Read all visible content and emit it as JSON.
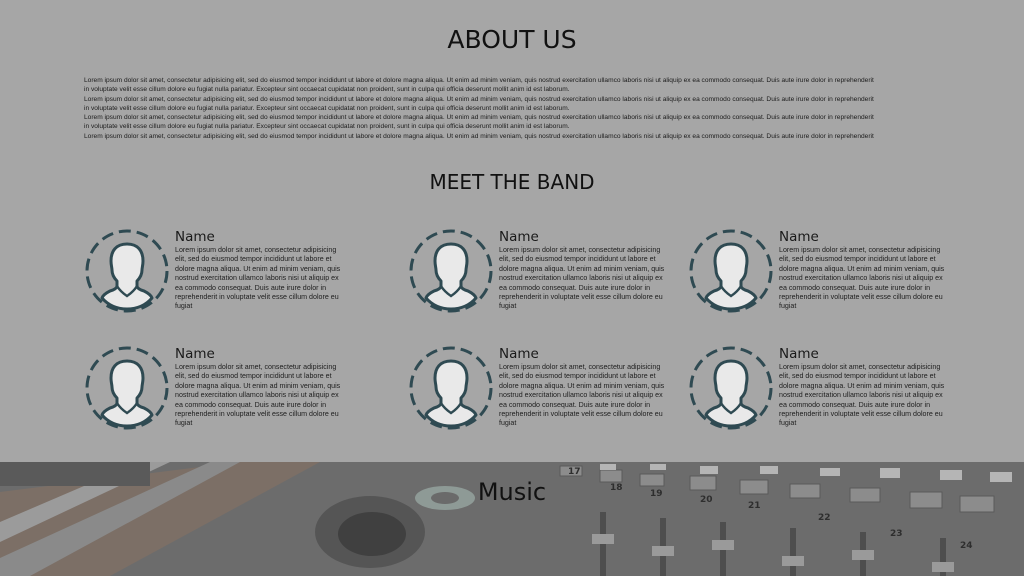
{
  "about": {
    "title": "ABOUT US",
    "paragraph_lines": [
      "Lorem ipsum dolor sit amet, consectetur adipisicing elit, sed do eiusmod tempor incididunt ut labore et dolore magna aliqua. Ut enim ad minim veniam, quis nostrud exercitation ullamco laboris nisi ut aliquip ex ea commodo consequat. Duis aute irure dolor in reprehenderit",
      "in voluptate velit esse cillum dolore eu fugiat nulla pariatur. Excepteur sint occaecat cupidatat non proident, sunt in culpa qui officia deserunt mollit anim id est laborum.",
      "Lorem ipsum dolor sit amet, consectetur adipisicing elit, sed do eiusmod tempor incididunt ut labore et dolore magna aliqua. Ut enim ad minim veniam, quis nostrud exercitation ullamco laboris nisi ut aliquip ex ea commodo consequat. Duis aute irure dolor in reprehenderit",
      "in voluptate velit esse cillum dolore eu fugiat nulla pariatur. Excepteur sint occaecat cupidatat non proident, sunt in culpa qui officia deserunt mollit anim id est laborum.",
      "Lorem ipsum dolor sit amet, consectetur adipisicing elit, sed do eiusmod tempor incididunt ut labore et dolore magna aliqua. Ut enim ad minim veniam, quis nostrud exercitation ullamco laboris nisi ut aliquip ex ea commodo consequat. Duis aute irure dolor in reprehenderit",
      "in voluptate velit esse cillum dolore eu fugiat nulla pariatur. Excepteur sint occaecat cupidatat non proident, sunt in culpa qui officia deserunt mollit anim id est laborum.",
      "Lorem ipsum dolor sit amet, consectetur adipisicing elit, sed do eiusmod tempor incididunt ut labore et dolore magna aliqua. Ut enim ad minim veniam, quis nostrud exercitation ullamco laboris nisi ut aliquip ex ea commodo consequat. Duis aute irure dolor in reprehenderit"
    ]
  },
  "band": {
    "title": "MEET THE BAND",
    "avatar_icon": "user-avatar-icon",
    "avatar_color": "#2f4a52",
    "members": [
      {
        "name": "Name",
        "bio": "Lorem ipsum dolor sit amet, consectetur adipisicing elit, sed do eiusmod tempor incididunt ut labore et dolore magna aliqua. Ut enim ad minim veniam, quis nostrud exercitation ullamco laboris nisi ut aliquip ex ea commodo consequat. Duis aute irure dolor in reprehenderit in voluptate velit esse cillum dolore eu fugiat"
      },
      {
        "name": "Name",
        "bio": "Lorem ipsum dolor sit amet, consectetur adipisicing elit, sed do eiusmod tempor incididunt ut labore et dolore magna aliqua. Ut enim ad minim veniam, quis nostrud exercitation ullamco laboris nisi ut aliquip ex ea commodo consequat. Duis aute irure dolor in reprehenderit in voluptate velit esse cillum dolore eu fugiat"
      },
      {
        "name": "Name",
        "bio": "Lorem ipsum dolor sit amet, consectetur adipisicing elit, sed do eiusmod tempor incididunt ut labore et dolore magna aliqua. Ut enim ad minim veniam, quis nostrud exercitation ullamco laboris nisi ut aliquip ex ea commodo consequat. Duis aute irure dolor in reprehenderit in voluptate velit esse cillum dolore eu fugiat"
      },
      {
        "name": "Name",
        "bio": "Lorem ipsum dolor sit amet, consectetur adipisicing elit, sed do eiusmod tempor incididunt ut labore et dolore magna aliqua. Ut enim ad minim veniam, quis nostrud exercitation ullamco laboris nisi ut aliquip ex ea commodo consequat. Duis aute irure dolor in reprehenderit in voluptate velit esse cillum dolore eu fugiat"
      },
      {
        "name": "Name",
        "bio": "Lorem ipsum dolor sit amet, consectetur adipisicing elit, sed do eiusmod tempor incididunt ut labore et dolore magna aliqua. Ut enim ad minim veniam, quis nostrud exercitation ullamco laboris nisi ut aliquip ex ea commodo consequat. Duis aute irure dolor in reprehenderit in voluptate velit esse cillum dolore eu fugiat"
      },
      {
        "name": "Name",
        "bio": "Lorem ipsum dolor sit amet, consectetur adipisicing elit, sed do eiusmod tempor incididunt ut labore et dolore magna aliqua. Ut enim ad minim veniam, quis nostrud exercitation ullamco laboris nisi ut aliquip ex ea commodo consequat. Duis aute irure dolor in reprehenderit in voluptate velit esse cillum dolore eu fugiat"
      }
    ]
  },
  "music": {
    "title": "Music",
    "background_image": "mixing-console-photo",
    "channel_numbers": [
      "17",
      "18",
      "19",
      "20",
      "21",
      "22",
      "23",
      "24"
    ]
  },
  "colors": {
    "page_background": "#a6a6a6",
    "text": "#111111"
  }
}
